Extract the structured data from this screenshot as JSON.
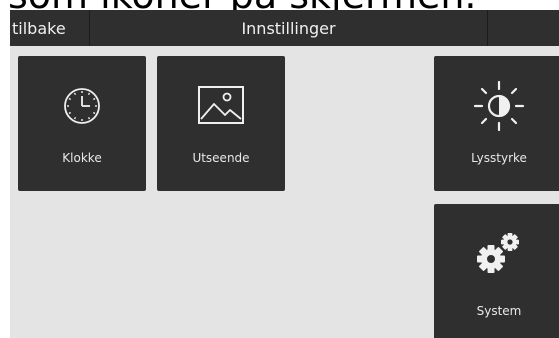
{
  "caption": "som ikoner på skjermen.",
  "topbar": {
    "back_label": "tilbake",
    "title": "Innstillinger"
  },
  "tiles": {
    "clock": {
      "label": "Klokke",
      "icon": "clock-icon"
    },
    "appearance": {
      "label": "Utseende",
      "icon": "image-icon"
    },
    "brightness": {
      "label": "Lysstyrke",
      "icon": "brightness-icon"
    },
    "system": {
      "label": "System",
      "icon": "gears-icon"
    }
  },
  "colors": {
    "background": "#e4e4e4",
    "tile": "#2f2f2f",
    "text": "#f0f0f0"
  }
}
